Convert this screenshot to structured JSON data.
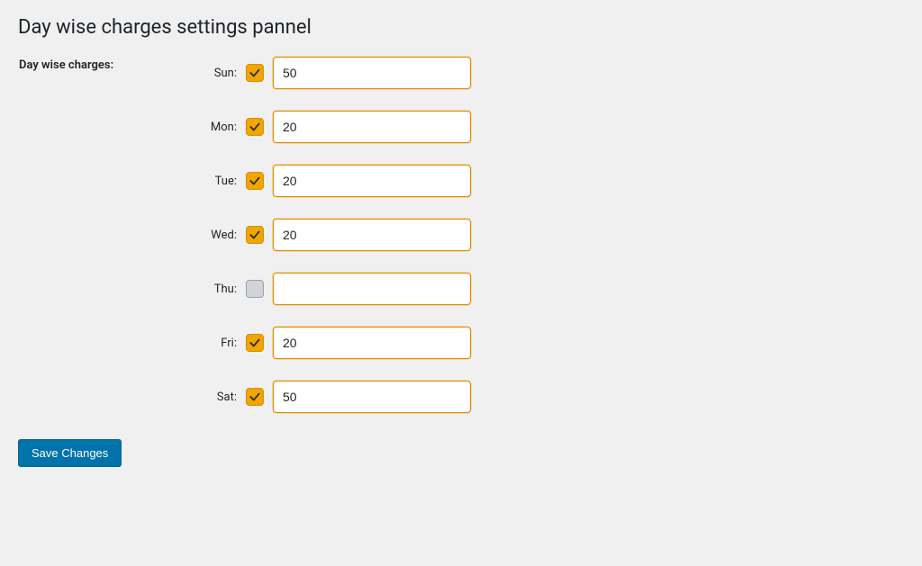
{
  "page": {
    "title": "Day wise charges settings pannel",
    "section_label": "Day wise charges:",
    "save_label": "Save Changes"
  },
  "days": {
    "sun": {
      "label": "Sun:",
      "enabled": true,
      "value": "50"
    },
    "mon": {
      "label": "Mon:",
      "enabled": true,
      "value": "20"
    },
    "tue": {
      "label": "Tue:",
      "enabled": true,
      "value": "20"
    },
    "wed": {
      "label": "Wed:",
      "enabled": true,
      "value": "20"
    },
    "thu": {
      "label": "Thu:",
      "enabled": false,
      "value": ""
    },
    "fri": {
      "label": "Fri:",
      "enabled": true,
      "value": "20"
    },
    "sat": {
      "label": "Sat:",
      "enabled": true,
      "value": "50"
    }
  },
  "colors": {
    "accent_orange": "#f0a500",
    "accent_blue": "#0073aa"
  }
}
